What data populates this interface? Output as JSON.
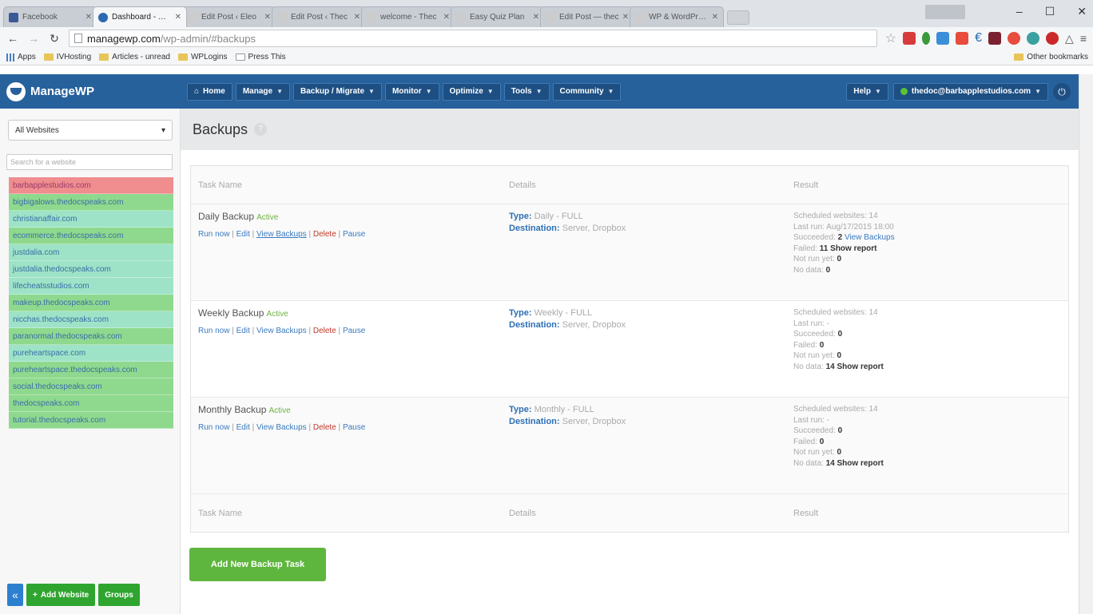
{
  "browser": {
    "tabs": [
      {
        "title": "Facebook",
        "active": false,
        "favicon_color": "#3b5998"
      },
      {
        "title": "Dashboard - ManageWP",
        "active": true,
        "favicon_color": "#2a6ab0"
      },
      {
        "title": "Edit Post ‹ Eleo",
        "active": false,
        "favicon_color": "#bbbbbb"
      },
      {
        "title": "Edit Post ‹ Thec",
        "active": false,
        "favicon_color": "#bbbbbb"
      },
      {
        "title": "welcome - Thec",
        "active": false,
        "favicon_color": "#bbbbbb"
      },
      {
        "title": "Easy Quiz Plan",
        "active": false,
        "favicon_color": "#bbbbbb"
      },
      {
        "title": "Edit Post — thec",
        "active": false,
        "favicon_color": "#bbbbbb"
      },
      {
        "title": "WP & WordPress",
        "active": false,
        "favicon_color": "#bbbbbb"
      }
    ],
    "window_controls": {
      "minimize": "–",
      "maximize": "☐",
      "close": "✕"
    },
    "url_host": "managewp.com",
    "url_path": "/wp-admin/#backups",
    "bookmarks": [
      "Apps",
      "IVHosting",
      "Articles - unread",
      "WPLogins",
      "Press This"
    ],
    "other_bookmarks": "Other bookmarks"
  },
  "app": {
    "logo": "ManageWP",
    "menu": [
      {
        "label": "Home",
        "icon": "home-icon",
        "dropdown": false
      },
      {
        "label": "Manage",
        "dropdown": true
      },
      {
        "label": "Backup / Migrate",
        "dropdown": true
      },
      {
        "label": "Monitor",
        "dropdown": true
      },
      {
        "label": "Optimize",
        "dropdown": true
      },
      {
        "label": "Tools",
        "dropdown": true
      },
      {
        "label": "Community",
        "dropdown": true
      }
    ],
    "help_label": "Help",
    "user_label": "thedoc@barbapplestudios.com",
    "colors": {
      "topbar": "#27619c",
      "green": "#5fb63e",
      "link": "#3a7abf"
    }
  },
  "sidebar": {
    "filter_value": "All Websites",
    "search_placeholder": "Search for a website",
    "sites": [
      {
        "name": "barbapplestudios.com",
        "status": "red"
      },
      {
        "name": "bigbigalows.thedocspeaks.com",
        "status": "green"
      },
      {
        "name": "christianaffair.com",
        "status": "teal"
      },
      {
        "name": "ecommerce.thedocspeaks.com",
        "status": "green"
      },
      {
        "name": "justdalia.com",
        "status": "teal"
      },
      {
        "name": "justdalia.thedocspeaks.com",
        "status": "teal"
      },
      {
        "name": "lifecheatsstudios.com",
        "status": "teal"
      },
      {
        "name": "makeup.thedocspeaks.com",
        "status": "green"
      },
      {
        "name": "nicchas.thedocspeaks.com",
        "status": "teal"
      },
      {
        "name": "paranormal.thedocspeaks.com",
        "status": "green"
      },
      {
        "name": "pureheartspace.com",
        "status": "teal"
      },
      {
        "name": "pureheartspace.thedocspeaks.com",
        "status": "green"
      },
      {
        "name": "social.thedocspeaks.com",
        "status": "green"
      },
      {
        "name": "thedocspeaks.com",
        "status": "green"
      },
      {
        "name": "tutorial.thedocspeaks.com",
        "status": "green"
      }
    ],
    "add_website": "Add Website",
    "groups": "Groups"
  },
  "page": {
    "title": "Backups",
    "help": "?",
    "columns": {
      "task": "Task Name",
      "details": "Details",
      "result": "Result"
    },
    "actions": {
      "run_now": "Run now",
      "edit": "Edit",
      "view": "View Backups",
      "delete": "Delete",
      "pause": "Pause"
    },
    "status_active": "Active",
    "details_labels": {
      "type": "Type:",
      "destination": "Destination:"
    },
    "result_labels": {
      "scheduled": "Scheduled websites:",
      "last_run": "Last run:",
      "succeeded": "Succeeded:",
      "failed": "Failed:",
      "not_run": "Not run yet:",
      "no_data": "No data:",
      "show_report": "Show report",
      "view_backups": "View Backups"
    },
    "tasks": [
      {
        "name": "Daily Backup",
        "type": "Daily - FULL",
        "destination": "Server, Dropbox",
        "scheduled": "14",
        "last_run": "Aug/17/2015 18:00",
        "succeeded": "2",
        "failed": "11",
        "not_run": "0",
        "no_data": "0"
      },
      {
        "name": "Weekly Backup",
        "type": "Weekly - FULL",
        "destination": "Server, Dropbox",
        "scheduled": "14",
        "last_run": "-",
        "succeeded": "0",
        "failed": "0",
        "not_run": "0",
        "no_data": "14"
      },
      {
        "name": "Monthly Backup",
        "type": "Monthly - FULL",
        "destination": "Server, Dropbox",
        "scheduled": "14",
        "last_run": "-",
        "succeeded": "0",
        "failed": "0",
        "not_run": "0",
        "no_data": "14"
      }
    ],
    "add_task": "Add New Backup Task"
  }
}
